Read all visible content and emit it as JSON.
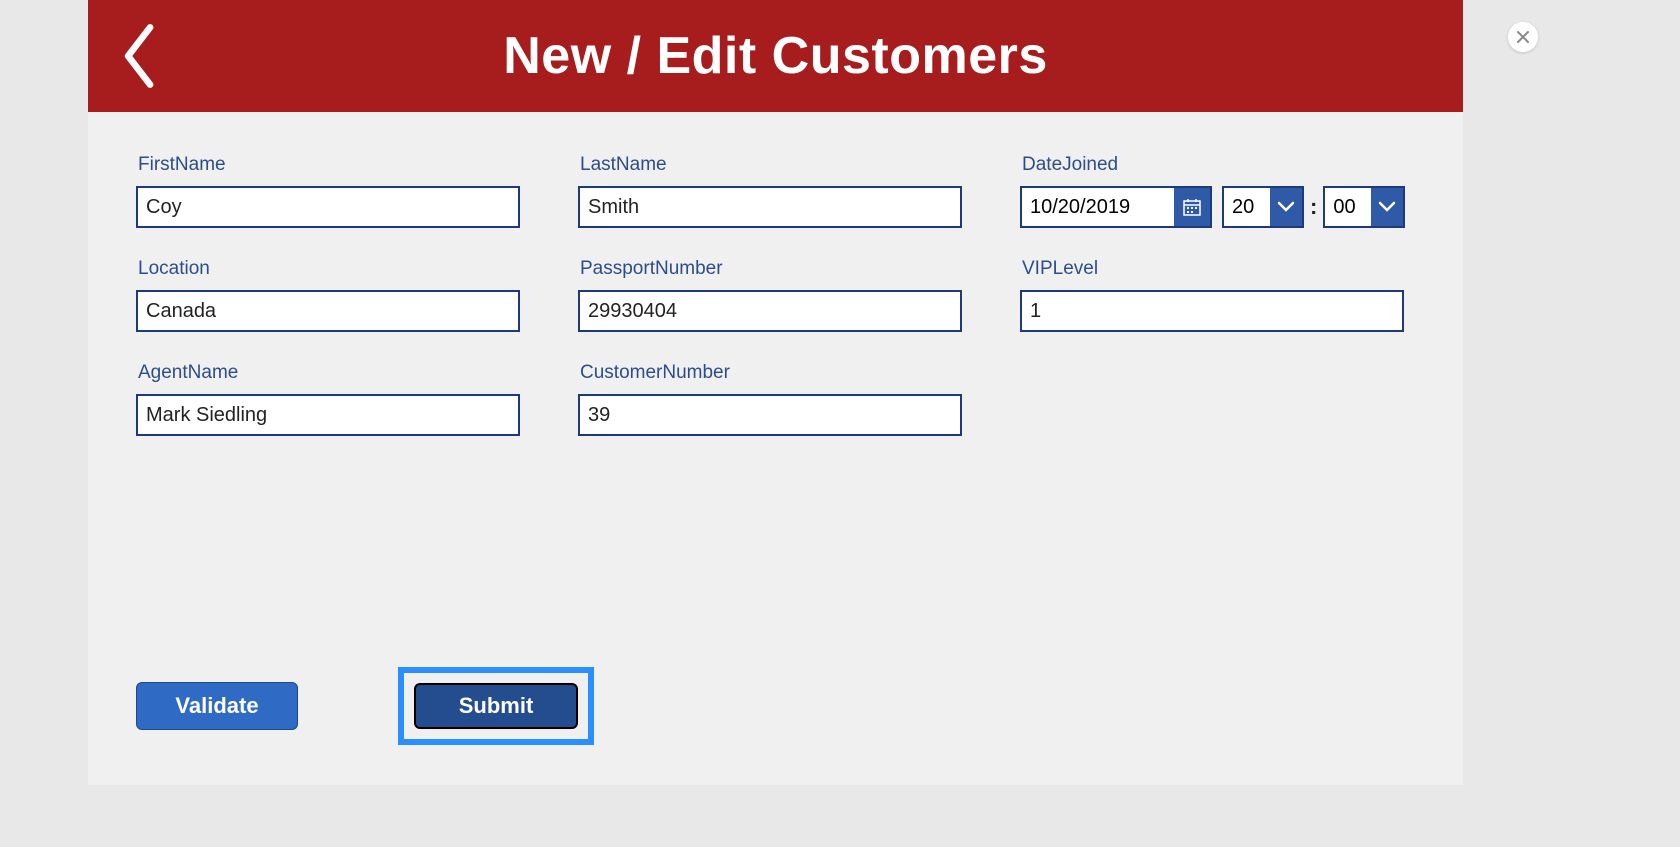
{
  "header": {
    "title": "New / Edit Customers"
  },
  "fields": {
    "firstName": {
      "label": "FirstName",
      "value": "Coy"
    },
    "lastName": {
      "label": "LastName",
      "value": "Smith"
    },
    "dateJoined": {
      "label": "DateJoined",
      "date": "10/20/2019",
      "hour": "20",
      "minute": "00"
    },
    "location": {
      "label": "Location",
      "value": "Canada"
    },
    "passportNumber": {
      "label": "PassportNumber",
      "value": "29930404"
    },
    "vipLevel": {
      "label": "VIPLevel",
      "value": "1"
    },
    "agentName": {
      "label": "AgentName",
      "value": "Mark Siedling"
    },
    "customerNumber": {
      "label": "CustomerNumber",
      "value": "39"
    }
  },
  "buttons": {
    "validate": "Validate",
    "submit": "Submit"
  },
  "time_separator": ":"
}
